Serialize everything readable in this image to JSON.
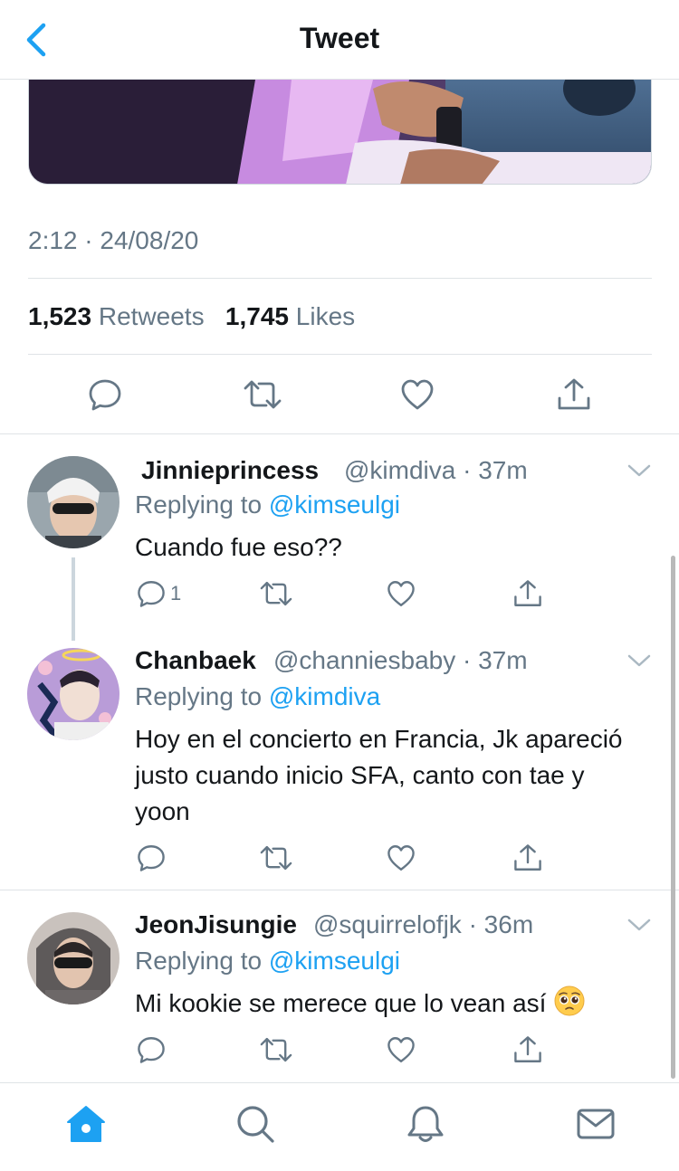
{
  "header": {
    "title": "Tweet"
  },
  "tweet": {
    "timestamp": "2:12 · 24/08/20",
    "retweets_count": "1,523",
    "retweets_label": "Retweets",
    "likes_count": "1,745",
    "likes_label": "Likes"
  },
  "replies": [
    {
      "name": "Jinnieprincess",
      "handle": "@kimdiva · 37m",
      "replying_label": "Replying to",
      "replying_to": "@kimseulgi",
      "text": "Cuando fue eso??",
      "reply_count": "1"
    },
    {
      "name": "Chanbaek",
      "handle": "@channiesbaby · 37m",
      "replying_label": "Replying to",
      "replying_to": "@kimdiva",
      "text": "Hoy en el concierto en Francia, Jk apareció justo cuando inicio SFA, canto con tae y yoon",
      "reply_count": ""
    },
    {
      "name": "JeonJisungie",
      "handle": "@squirrelofjk · 36m",
      "replying_label": "Replying to",
      "replying_to": "@kimseulgi",
      "text": "Mi kookie se merece que lo vean así",
      "reply_count": ""
    }
  ],
  "icons": {
    "back": "chevron-left-icon",
    "reply": "speech-bubble-icon",
    "retweet": "retweet-icon",
    "like": "heart-icon",
    "share": "share-icon",
    "more": "chevron-down-icon",
    "tabs": [
      "home-icon",
      "search-icon",
      "bell-icon",
      "mail-icon"
    ]
  },
  "colors": {
    "accent": "#1da1f2",
    "text": "#14171a",
    "secondary": "#657786",
    "divider": "#dfe3e6"
  }
}
